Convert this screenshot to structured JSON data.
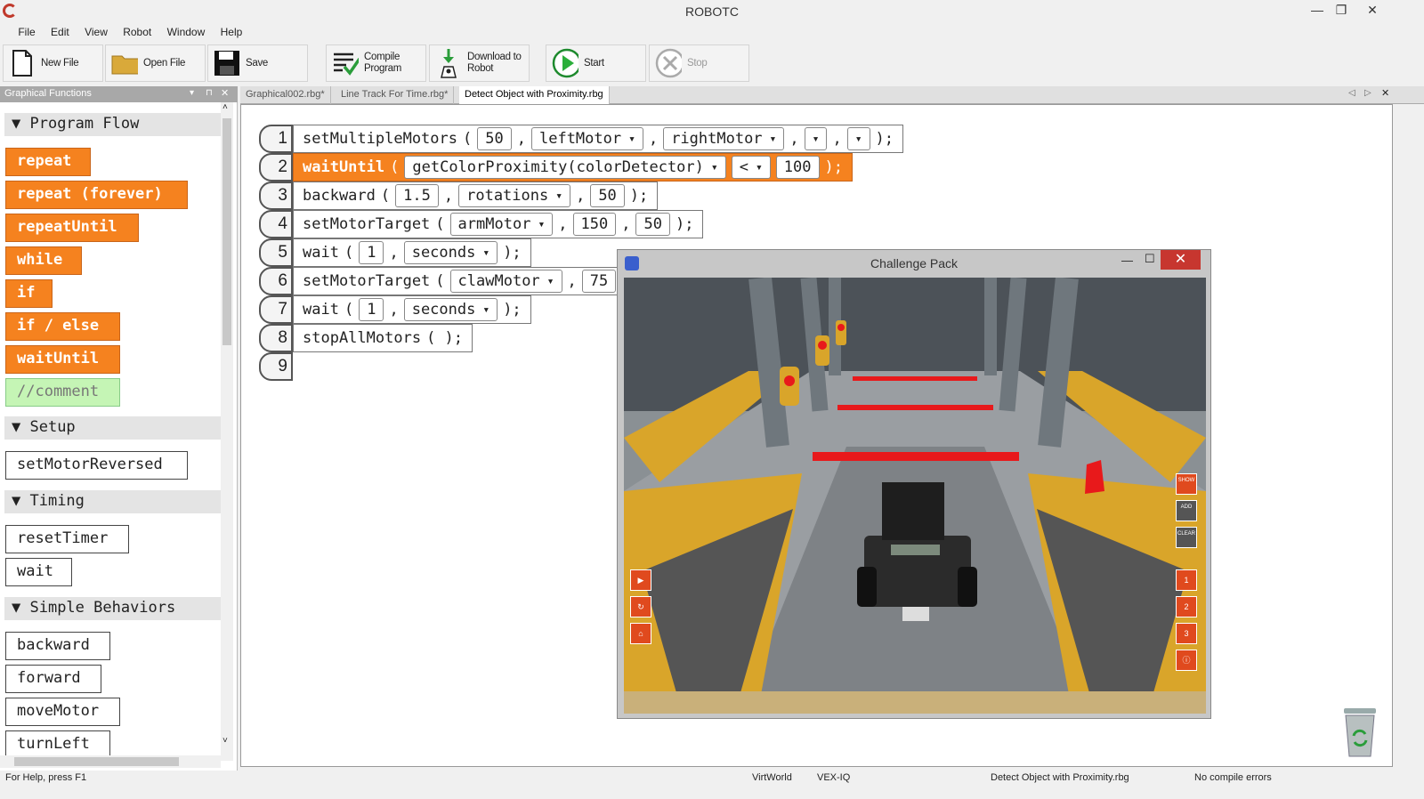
{
  "window": {
    "title": "ROBOTC",
    "min": "—",
    "max": "❐",
    "close": "✕"
  },
  "menu": [
    "File",
    "Edit",
    "View",
    "Robot",
    "Window",
    "Help"
  ],
  "toolbar": {
    "new_file": "New File",
    "open_file": "Open File",
    "save": "Save",
    "compile": [
      "Compile",
      "Program"
    ],
    "download": [
      "Download to",
      "Robot"
    ],
    "start": "Start",
    "stop": "Stop"
  },
  "left_panel": {
    "header": "Graphical Functions",
    "sections": {
      "program_flow": "Program Flow",
      "setup": "Setup",
      "timing": "Timing",
      "simple_behaviors": "Simple Behaviors"
    },
    "program_flow_items": [
      "repeat",
      "repeat (forever)",
      "repeatUntil",
      "while",
      "if",
      "if / else",
      "waitUntil",
      "//comment"
    ],
    "setup_items": [
      "setMotorReversed"
    ],
    "timing_items": [
      "resetTimer",
      "wait"
    ],
    "behavior_items": [
      "backward",
      "forward",
      "moveMotor",
      "turnLeft"
    ]
  },
  "tabs": [
    "Graphical002.rbg*",
    "Line Track For Time.rbg*",
    "Detect Object with Proximity.rbg"
  ],
  "code": {
    "numbers": [
      "1",
      "2",
      "3",
      "4",
      "5",
      "6",
      "7",
      "8",
      "9"
    ],
    "l1": {
      "fn": "setMultipleMotors",
      "a": "50",
      "b": "leftMotor",
      "c": "rightMotor"
    },
    "l2": {
      "fn": "waitUntil",
      "a": "getColorProximity(colorDetector)",
      "op": "<",
      "v": "100"
    },
    "l3": {
      "fn": "backward",
      "a": "1.5",
      "b": "rotations",
      "c": "50"
    },
    "l4": {
      "fn": "setMotorTarget",
      "a": "armMotor",
      "b": "150",
      "c": "50"
    },
    "l5": {
      "fn": "wait",
      "a": "1",
      "b": "seconds"
    },
    "l6": {
      "fn": "setMotorTarget",
      "a": "clawMotor",
      "b": "75"
    },
    "l7": {
      "fn": "wait",
      "a": "1",
      "b": "seconds"
    },
    "l8": {
      "fn": "stopAllMotors"
    }
  },
  "challenge": {
    "title": "Challenge Pack",
    "side_labels": [
      "SHOW",
      "ADD",
      "CLEAR"
    ]
  },
  "status": {
    "help": "For Help, press F1",
    "world": "VirtWorld",
    "platform": "VEX-IQ",
    "file": "Detect Object with Proximity.rbg",
    "compile": "No compile errors"
  }
}
